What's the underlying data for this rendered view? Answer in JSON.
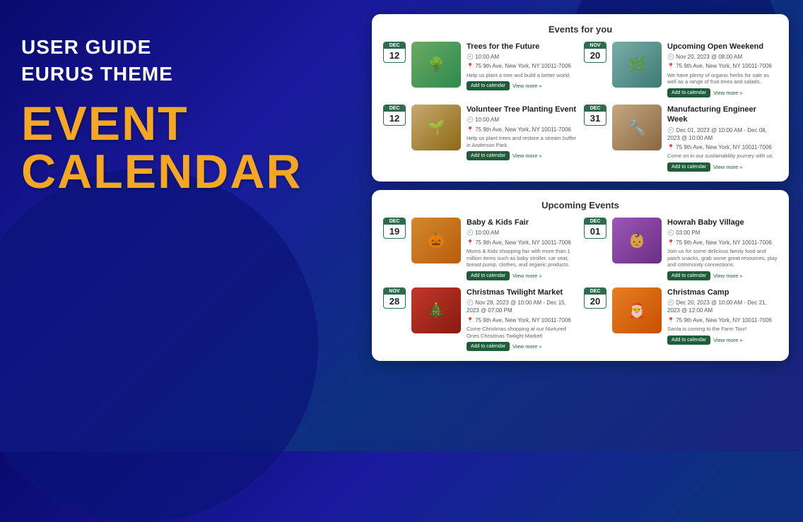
{
  "left": {
    "user_guide": "USER GUIDE",
    "eurus_theme": "EURUS THEME",
    "event_calendar_line1": "EVENT",
    "event_calendar_line2": "CALENDAR"
  },
  "widget1": {
    "title": "Events for you",
    "events": [
      {
        "id": "trees-future",
        "date_day": "12",
        "date_month": "Dec",
        "name": "Trees for the Future",
        "time": "10:00 AM",
        "location": "75 9th Ave, New York, NY 10011-7006",
        "desc": "Help us plant a tree and build a better world.",
        "img_class": "img-trees",
        "add_cal_label": "Add to calendar",
        "view_more_label": "View more »"
      },
      {
        "id": "upcoming-open",
        "date_day": "20",
        "date_month": "Nov",
        "name": "Upcoming Open Weekend",
        "time": "Nov 20, 2023 @ 08:00 AM",
        "location": "75 9th Ave, New York, NY 10011-7006",
        "desc": "We have plenty of organic herbs for sale as well as a range of fruit trees and salads.",
        "img_class": "img-upcoming",
        "add_cal_label": "Add to calendar",
        "view_more_label": "View more »"
      },
      {
        "id": "volunteer-tree",
        "date_day": "12",
        "date_month": "Dec",
        "name": "Volunteer Tree Planting Event",
        "time": "10:00 AM",
        "location": "75 9th Ave, New York, NY 10011-7006",
        "desc": "Help us plant trees and restore a stream buffer in Anderson Park.",
        "img_class": "img-volunteer",
        "add_cal_label": "Add to calendar",
        "view_more_label": "View more »"
      },
      {
        "id": "manufacturing",
        "date_day": "31",
        "date_month": "Dec",
        "name": "Manufacturing Engineer Week",
        "time": "Dec 01, 2023 @ 10:00 AM - Dec 08, 2023 @ 10:00 AM",
        "location": "75 9th Ave, New York, NY 10011-7006",
        "desc": "Come on in our sustainability journey with us.",
        "img_class": "img-manufacturing",
        "add_cal_label": "Add to calendar",
        "view_more_label": "View more »"
      }
    ]
  },
  "widget2": {
    "title": "Upcoming Events",
    "events": [
      {
        "id": "baby-kids",
        "date_day": "19",
        "date_month": "Dec",
        "name": "Baby & Kids Fair",
        "time": "10:00 AM",
        "location": "75 9th Ave, New York, NY 10011-7006",
        "desc": "Mums & Kids shopping fair with more than 1 million items such as baby stroller, car seat, breast pump, clothes, and organic products.",
        "img_class": "img-baby",
        "add_cal_label": "Add to calendar",
        "view_more_label": "View more »"
      },
      {
        "id": "howrah-baby",
        "date_day": "01",
        "date_month": "Dec",
        "name": "Howrah Baby Village",
        "time": "03:00 PM",
        "location": "75 9th Ave, New York, NY 10011-7006",
        "desc": "Join us for some delicious family food and patch snacks, grab some great resources, play and community connections.",
        "img_class": "img-howrah",
        "add_cal_label": "Add to calendar",
        "view_more_label": "View more »"
      },
      {
        "id": "christmas-twilight",
        "date_day": "28",
        "date_month": "Nov",
        "name": "Christmas Twilight Market",
        "time": "Nov 28, 2023 @ 10:00 AM - Dec 15, 2023 @ 07:00 PM",
        "location": "75 9th Ave, New York, NY 10011-7006",
        "desc": "Come Christmas shopping at our Nurtured Ones Christmas Twilight Market!",
        "img_class": "img-christmas-twilight",
        "add_cal_label": "Add to calendar",
        "view_more_label": "View more »"
      },
      {
        "id": "christmas-camp",
        "date_day": "20",
        "date_month": "Dec",
        "name": "Christmas Camp",
        "time": "Dec 20, 2023 @ 10:00 AM - Dec 21, 2023 @ 12:00 AM",
        "location": "75 9th Ave, New York, NY 10011-7006",
        "desc": "Santa is coming to the Farm Tour!",
        "img_class": "img-christmas-camp",
        "add_cal_label": "Add to calendar",
        "view_more_label": "View more »"
      }
    ]
  }
}
